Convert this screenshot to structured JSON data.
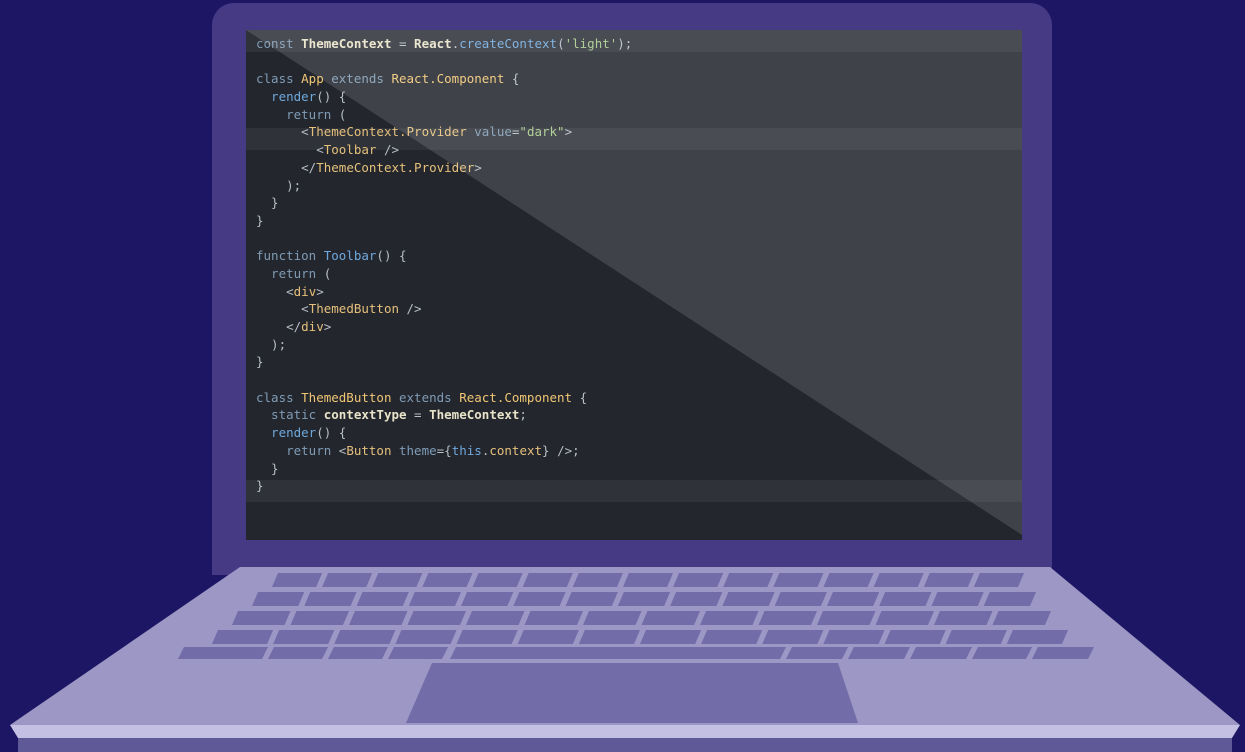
{
  "colors": {
    "background": "#1d1664",
    "lid": "#463a84",
    "screen": "#23262d",
    "keyboard_deck": "#9c97c4",
    "keys": "#726ca8",
    "trackpad": "#726ca8",
    "base_edge": "#c0bee0"
  },
  "code": {
    "lines": [
      [
        [
          "kw",
          "const "
        ],
        [
          "id",
          "ThemeContext"
        ],
        [
          "pl",
          " = "
        ],
        [
          "id",
          "React"
        ],
        [
          "pl",
          "."
        ],
        [
          "fn",
          "createContext"
        ],
        [
          "pl",
          "("
        ],
        [
          "str",
          "'light'"
        ],
        [
          "pl",
          ");"
        ]
      ],
      [],
      [
        [
          "kw",
          "class "
        ],
        [
          "cls",
          "App"
        ],
        [
          "kw",
          " extends "
        ],
        [
          "cls",
          "React.Component"
        ],
        [
          "pl",
          " {"
        ]
      ],
      [
        [
          "fn",
          "  render"
        ],
        [
          "pl",
          "() {"
        ]
      ],
      [
        [
          "kw",
          "    return "
        ],
        [
          "pl",
          "("
        ]
      ],
      [
        [
          "pl",
          "      <"
        ],
        [
          "tag",
          "ThemeContext.Provider"
        ],
        [
          "kw",
          " value"
        ],
        [
          "pl",
          "="
        ],
        [
          "str",
          "\"dark\""
        ],
        [
          "pl",
          ">"
        ]
      ],
      [
        [
          "pl",
          "        <"
        ],
        [
          "tag",
          "Toolbar"
        ],
        [
          "pl",
          " />"
        ]
      ],
      [
        [
          "pl",
          "      </"
        ],
        [
          "tag",
          "ThemeContext.Provider"
        ],
        [
          "pl",
          ">"
        ]
      ],
      [
        [
          "pl",
          "    );"
        ]
      ],
      [
        [
          "pl",
          "  }"
        ]
      ],
      [
        [
          "pl",
          "}"
        ]
      ],
      [],
      [
        [
          "kw",
          "function "
        ],
        [
          "fn",
          "Toolbar"
        ],
        [
          "pl",
          "() {"
        ]
      ],
      [
        [
          "kw",
          "  return "
        ],
        [
          "pl",
          "("
        ]
      ],
      [
        [
          "pl",
          "    <"
        ],
        [
          "tag",
          "div"
        ],
        [
          "pl",
          ">"
        ]
      ],
      [
        [
          "pl",
          "      <"
        ],
        [
          "tag",
          "ThemedButton"
        ],
        [
          "pl",
          " />"
        ]
      ],
      [
        [
          "pl",
          "    </"
        ],
        [
          "tag",
          "div"
        ],
        [
          "pl",
          ">"
        ]
      ],
      [
        [
          "pl",
          "  );"
        ]
      ],
      [
        [
          "pl",
          "}"
        ]
      ],
      [],
      [
        [
          "kw",
          "class "
        ],
        [
          "cls",
          "ThemedButton"
        ],
        [
          "kw",
          " extends "
        ],
        [
          "cls",
          "React.Component"
        ],
        [
          "pl",
          " {"
        ]
      ],
      [
        [
          "kw",
          "  static "
        ],
        [
          "id",
          "contextType"
        ],
        [
          "pl",
          " = "
        ],
        [
          "id",
          "ThemeContext"
        ],
        [
          "pl",
          ";"
        ]
      ],
      [
        [
          "fn",
          "  render"
        ],
        [
          "pl",
          "() {"
        ]
      ],
      [
        [
          "kw",
          "    return "
        ],
        [
          "pl",
          "<"
        ],
        [
          "tag",
          "Button"
        ],
        [
          "kw",
          " theme"
        ],
        [
          "pl",
          "={"
        ],
        [
          "fn",
          "this"
        ],
        [
          "pl",
          "."
        ],
        [
          "tag",
          "context"
        ],
        [
          "pl",
          "} />;"
        ]
      ],
      [
        [
          "pl",
          "  }"
        ]
      ],
      [
        [
          "pl",
          "}"
        ]
      ]
    ]
  }
}
